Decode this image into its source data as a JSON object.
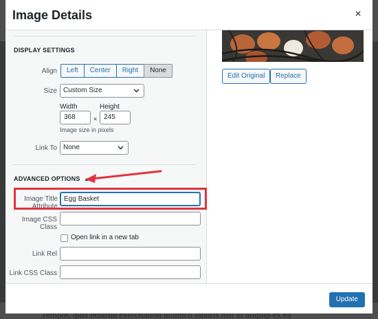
{
  "modal": {
    "title": "Image Details",
    "close_glyph": "×"
  },
  "display_settings": {
    "heading": "DISPLAY SETTINGS",
    "align_label": "Align",
    "align_options": [
      "Left",
      "Center",
      "Right",
      "None"
    ],
    "align_selected": "None",
    "size_label": "Size",
    "size_value": "Custom Size",
    "width_label": "Width",
    "width_value": "368",
    "height_label": "Height",
    "height_value": "245",
    "dimension_separator": "×",
    "size_hint": "Image size in pixels",
    "link_to_label": "Link To",
    "link_to_value": "None"
  },
  "advanced_options": {
    "heading": "ADVANCED OPTIONS",
    "toggle_glyph": "▲",
    "title_attr_label": "Image Title Attribute",
    "title_attr_value": "Egg Basket",
    "css_class_label": "Image CSS Class",
    "css_class_value": "",
    "new_tab_label": "Open link in a new tab",
    "new_tab_checked": false,
    "link_rel_label": "Link Rel",
    "link_rel_value": "",
    "link_css_label": "Link CSS Class",
    "link_css_value": ""
  },
  "image_panel": {
    "edit_original_label": "Edit Original",
    "replace_label": "Replace"
  },
  "footer": {
    "update_label": "Update"
  },
  "background": {
    "text": "Tempor, quis nostrud exercitation ullamco laboris nisi ut aliquip ex ea"
  },
  "colors": {
    "accent": "#2271b1",
    "highlight": "#e0333d"
  },
  "icons": {
    "close": "close-icon",
    "collapse": "triangle-up-icon",
    "select": "chevron-down-icon",
    "annotation": "red-arrow-icon"
  }
}
